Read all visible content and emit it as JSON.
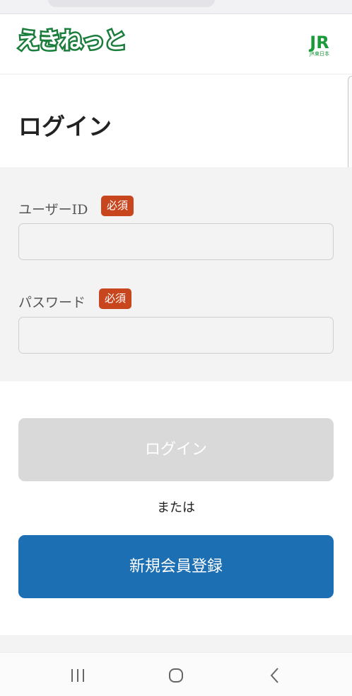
{
  "header": {
    "logo_text": "えきねっと",
    "jr_logo_letters": "JR",
    "jr_logo_subtext": "JR東日本",
    "brand_color": "#1b7d3c"
  },
  "page": {
    "title": "ログイン"
  },
  "form": {
    "user_id_label": "ユーザーID",
    "password_label": "パスワード",
    "required_badge": "必須",
    "user_id_value": "",
    "password_value": "",
    "badge_color": "#c8461e"
  },
  "actions": {
    "login_label": "ログイン",
    "or_text": "または",
    "register_label": "新規会員登録",
    "register_color": "#1d6fb4",
    "login_disabled_color": "#d9d9d9"
  },
  "nav": {
    "items": [
      "recent-apps-icon",
      "home-icon",
      "back-icon"
    ]
  }
}
